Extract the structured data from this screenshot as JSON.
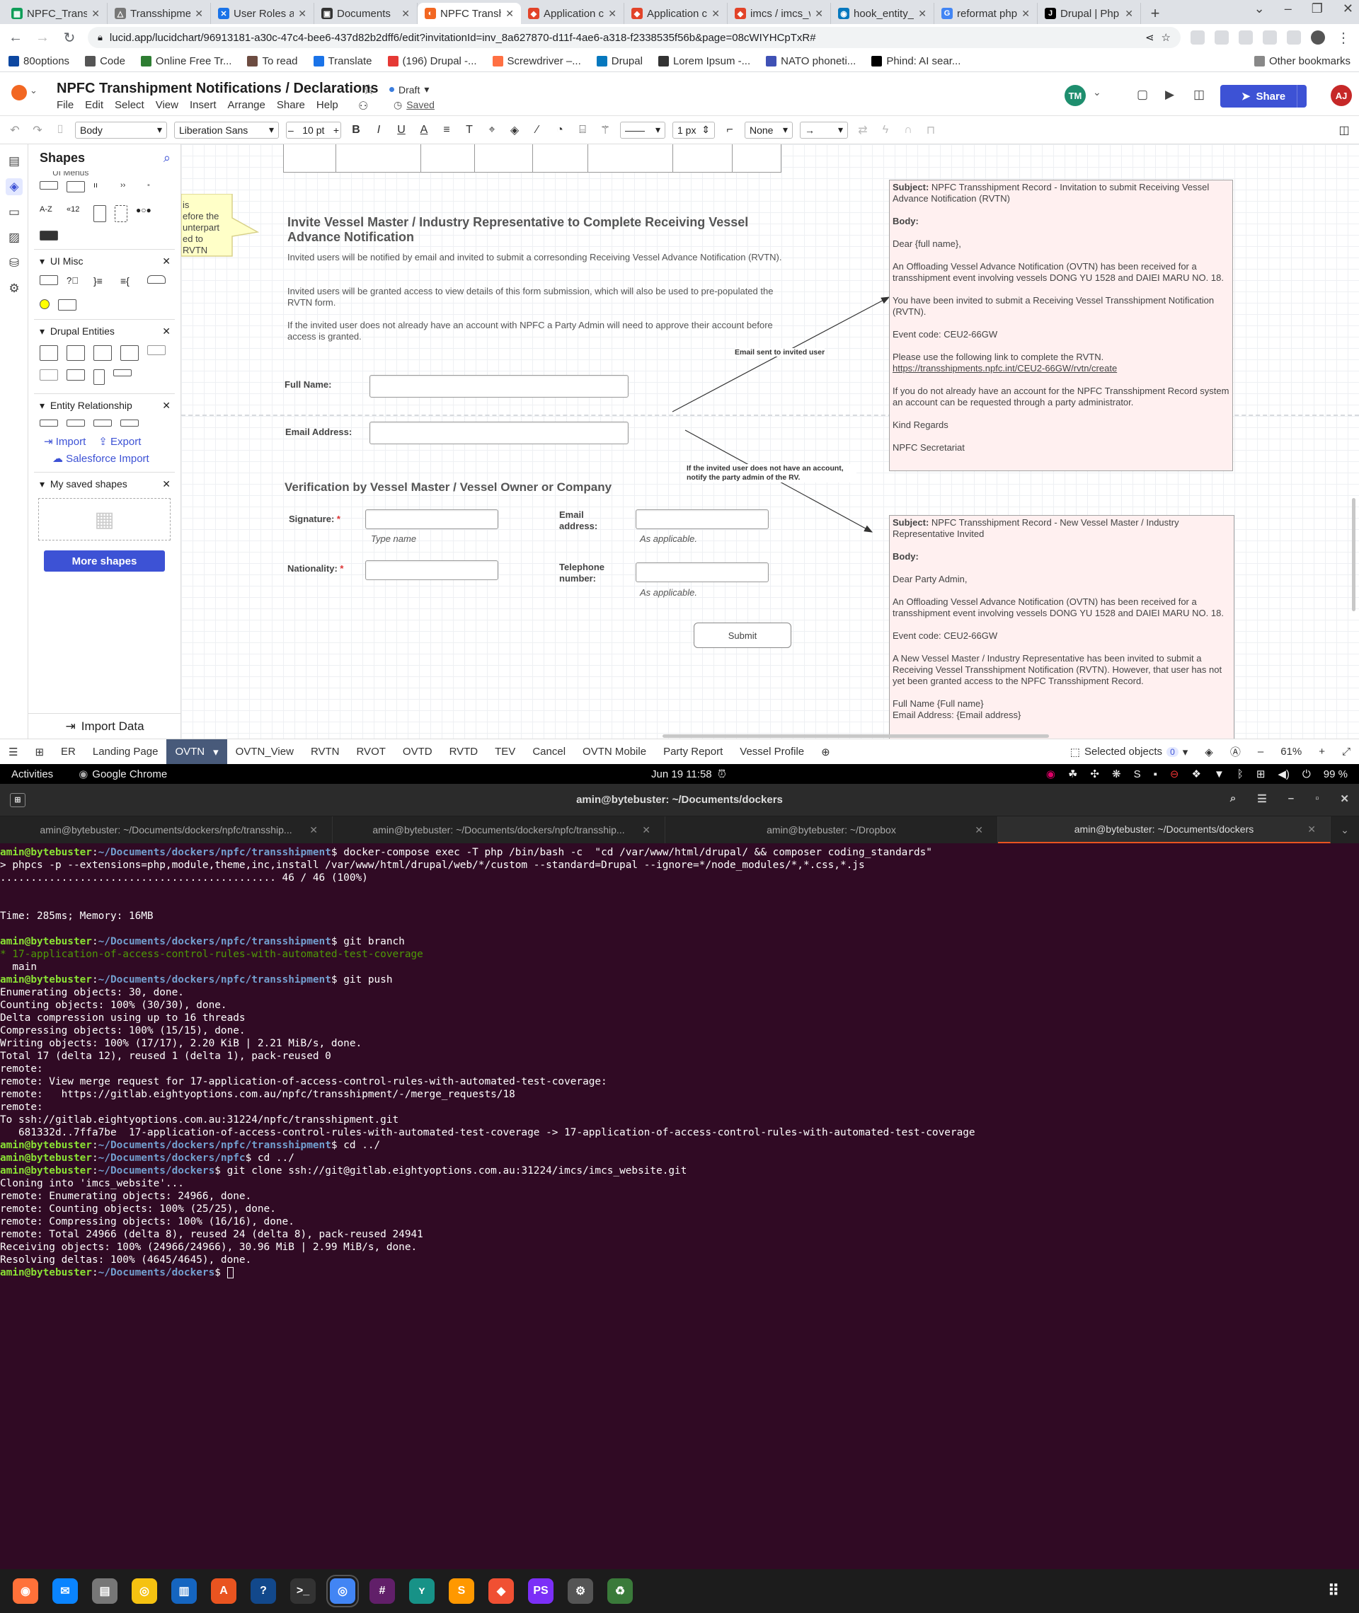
{
  "browser": {
    "tabs": [
      {
        "title": "NPFC_Transs",
        "color": "#0f9d58",
        "glyph": "▦"
      },
      {
        "title": "Transshipme",
        "color": "#777",
        "glyph": "△"
      },
      {
        "title": "User Roles an",
        "color": "#1a73e8",
        "glyph": "✕"
      },
      {
        "title": "Documents",
        "color": "#333",
        "glyph": "▣"
      },
      {
        "title": "NPFC Transh",
        "color": "#f26722",
        "glyph": "◐",
        "active": true
      },
      {
        "title": "Application c",
        "color": "#e24329",
        "glyph": "◆"
      },
      {
        "title": "Application c",
        "color": "#e24329",
        "glyph": "◆"
      },
      {
        "title": "imcs / imcs_w",
        "color": "#e24329",
        "glyph": "◆"
      },
      {
        "title": "hook_entity_",
        "color": "#0678be",
        "glyph": "◉"
      },
      {
        "title": "reformat php",
        "color": "#4285f4",
        "glyph": "G"
      },
      {
        "title": "Drupal | Php",
        "color": "#000",
        "glyph": "J"
      }
    ],
    "url": "lucid.app/lucidchart/96913181-a30c-47c4-bee6-437d82b2dff6/edit?invitationId=inv_8a627870-d11f-4ae6-a318-f2338535f56b&page=08cWIYHCpTxR#",
    "bookmarks": [
      "80options",
      "Code",
      "Online Free Tr...",
      "To read",
      "Translate",
      "(196) Drupal -...",
      "Screwdriver –...",
      "Drupal",
      "Lorem Ipsum -...",
      "NATO phoneti...",
      "Phind: AI sear..."
    ],
    "other_bookmarks": "Other bookmarks"
  },
  "app": {
    "title": "NPFC Transhipment Notifications / Declarations",
    "status": "Draft",
    "saved": "Saved",
    "menus": [
      "File",
      "Edit",
      "Select",
      "View",
      "Insert",
      "Arrange",
      "Share",
      "Help"
    ],
    "avatar_tm": "TM",
    "avatar_aj": "AJ",
    "share_label": "Share"
  },
  "toolbar": {
    "style": "Body",
    "font": "Liberation Sans",
    "size": "10 pt",
    "line_width": "1 px",
    "arrow_start": "None"
  },
  "shapes_panel": {
    "title": "Shapes",
    "partial_section": "UI Menus",
    "sections": [
      "UI Misc",
      "Drupal Entities",
      "Entity Relationship",
      "My saved shapes"
    ],
    "import": "Import",
    "export": "Export",
    "salesforce": "Salesforce Import",
    "more_shapes": "More shapes",
    "import_data": "Import Data",
    "glyphs": [
      "A-Z",
      "«12"
    ]
  },
  "canvas": {
    "note_text": [
      "is",
      "efore the",
      "unterpart",
      "ed to",
      "RVTN"
    ],
    "heading1": "Invite Vessel Master / Industry Representative to Complete Receiving Vessel Advance Notification",
    "para1": "Invited users will be notified by email and invited to submit a corresonding Receiving Vessel Advance Notification (RVTN).",
    "para2": "Invited users will be granted access to view details of this form submission, which will also be used to pre-populated the RVTN form.",
    "para3": "If the invited user does not already have an account with NPFC a Party Admin will need to approve their account before access is granted.",
    "full_name": "Full Name:",
    "email_address": "Email Address:",
    "heading2": "Verification by Vessel Master / Vessel Owner or Company",
    "signature": "Signature:",
    "nationality": "Nationality:",
    "required": "*",
    "type_name": "Type name",
    "email_label": "Email address:",
    "telephone_label": "Telephone number:",
    "as_applicable": "As applicable.",
    "submit": "Submit",
    "arrow_label1": "Email sent to invited user",
    "arrow_label2": "If the invited user does not have an account, notify the party admin of the RV.",
    "email1": {
      "subject_label": "Subject:",
      "subject": "NPFC Transshipment Record - Invitation to submit Receiving Vessel Advance Notification (RVTN)",
      "body_label": "Body:",
      "greeting": "Dear {full name},",
      "p1": "An Offloading Vessel Advance Notification (OVTN) has been received for a transshipment event involving vessels DONG YU 1528 and DAIEI MARU NO. 18.",
      "p2": "You have been invited to submit a Receiving Vessel Transshipment Notification (RVTN).",
      "p3": "Event code: CEU2-66GW",
      "p4": "Please use the following link to complete the RVTN.",
      "link": "https://transshipments.npfc.int/CEU2-66GW/rvtn/create",
      "p5": "If you do not already have an account for the NPFC Transshipment Record system an account can be requested through a party administrator.",
      "p6": "Kind Regards",
      "p7": "NPFC Secretariat"
    },
    "email2": {
      "subject_label": "Subject:",
      "subject": "NPFC Transshipment Record - New Vessel Master / Industry Representative Invited",
      "body_label": "Body:",
      "greeting": "Dear Party Admin,",
      "p1": "An Offloading Vessel Advance Notification (OVTN) has been received for a transshipment event involving vessels DONG YU 1528 and DAIEI MARU NO. 18.",
      "p2": "Event code: CEU2-66GW",
      "p3": "A New Vessel Master / Industry Representative has been invited to submit a Receiving Vessel Transshipment Notification (RVTN). However, that user has not yet been granted access to the NPFC Transshipment Record.",
      "p4a": "Full Name {Full name}",
      "p4b": "Email Address: {Email address}"
    }
  },
  "pagetabs": {
    "tabs": [
      "ER",
      "Landing Page",
      "OVTN",
      "OVTN_View",
      "RVTN",
      "RVOT",
      "OVTD",
      "RVTD",
      "TEV",
      "Cancel",
      "OVTN Mobile",
      "Party Report",
      "Vessel Profile"
    ],
    "active": "OVTN",
    "selected_objects": "Selected objects",
    "selected_count": "0",
    "zoom": "61%"
  },
  "ubuntu": {
    "activities": "Activities",
    "app": "Google Chrome",
    "clock": "Jun 19  11:58",
    "battery": "99 %"
  },
  "terminal": {
    "title": "amin@bytebuster: ~/Documents/dockers",
    "tabs": [
      "amin@bytebuster: ~/Documents/dockers/npfc/transship...",
      "amin@bytebuster: ~/Documents/dockers/npfc/transship...",
      "amin@bytebuster: ~/Dropbox",
      "amin@bytebuster: ~/Documents/dockers"
    ],
    "user": "amin@bytebuster",
    "path_tr": "~/Documents/dockers/npfc/transshipment",
    "path_npfc": "~/Documents/dockers/npfc",
    "path_dockers": "~/Documents/dockers",
    "cmd1": "docker-compose exec -T php /bin/bash -c  \"cd /var/www/html/drupal/ && composer coding_standards\"",
    "out1": "> phpcs -p --extensions=php,module,theme,inc,install /var/www/html/drupal/web/*/custom --standard=Drupal --ignore=*/node_modules/*,*.css,*.js",
    "out2": "............................................. 46 / 46 (100%)",
    "out3": "Time: 285ms; Memory: 16MB",
    "cmd2": "git branch",
    "branch_current": "* 17-application-of-access-control-rules-with-automated-test-coverage",
    "branch_main": "  main",
    "cmd3": "git push",
    "push_out": [
      "Enumerating objects: 30, done.",
      "Counting objects: 100% (30/30), done.",
      "Delta compression using up to 16 threads",
      "Compressing objects: 100% (15/15), done.",
      "Writing objects: 100% (17/17), 2.20 KiB | 2.21 MiB/s, done.",
      "Total 17 (delta 12), reused 1 (delta 1), pack-reused 0",
      "remote:",
      "remote: View merge request for 17-application-of-access-control-rules-with-automated-test-coverage:",
      "remote:   https://gitlab.eightyoptions.com.au/npfc/transshipment/-/merge_requests/18",
      "remote:",
      "To ssh://gitlab.eightyoptions.com.au:31224/npfc/transshipment.git",
      "   681332d..7ffa7be  17-application-of-access-control-rules-with-automated-test-coverage -> 17-application-of-access-control-rules-with-automated-test-coverage"
    ],
    "cmd4": "cd ../",
    "cmd5": "cd ../",
    "cmd6": "git clone ssh://git@gitlab.eightyoptions.com.au:31224/imcs/imcs_website.git",
    "clone_out": [
      "Cloning into 'imcs_website'...",
      "remote: Enumerating objects: 24966, done.",
      "remote: Counting objects: 100% (25/25), done.",
      "remote: Compressing objects: 100% (16/16), done.",
      "remote: Total 24966 (delta 8), reused 24 (delta 8), pack-reused 24941",
      "Receiving objects: 100% (24966/24966), 30.96 MiB | 2.99 MiB/s, done.",
      "Resolving deltas: 100% (4645/4645), done."
    ]
  },
  "dock": {
    "apps": [
      {
        "name": "firefox",
        "color": "#ff7139",
        "glyph": "◉"
      },
      {
        "name": "thunderbird",
        "color": "#0a84ff",
        "glyph": "✉"
      },
      {
        "name": "files",
        "color": "#777",
        "glyph": "▤"
      },
      {
        "name": "rhythmbox",
        "color": "#f5c211",
        "glyph": "◎"
      },
      {
        "name": "writer",
        "color": "#1565c0",
        "glyph": "▥"
      },
      {
        "name": "software",
        "color": "#e95420",
        "glyph": "A"
      },
      {
        "name": "help",
        "color": "#12488b",
        "glyph": "?"
      },
      {
        "name": "terminal",
        "color": "#333",
        "glyph": ">_"
      },
      {
        "name": "chrome",
        "color": "#4285f4",
        "glyph": "◎"
      },
      {
        "name": "slack",
        "color": "#611f69",
        "glyph": "#"
      },
      {
        "name": "gitkraken",
        "color": "#179287",
        "glyph": "ʏ"
      },
      {
        "name": "sublime",
        "color": "#ff9800",
        "glyph": "S"
      },
      {
        "name": "git",
        "color": "#f05033",
        "glyph": "◆"
      },
      {
        "name": "phpstorm",
        "color": "#7b2ff7",
        "glyph": "PS"
      },
      {
        "name": "settings",
        "color": "#555",
        "glyph": "⚙"
      },
      {
        "name": "trash",
        "color": "#3a7a3a",
        "glyph": "♻"
      }
    ]
  }
}
